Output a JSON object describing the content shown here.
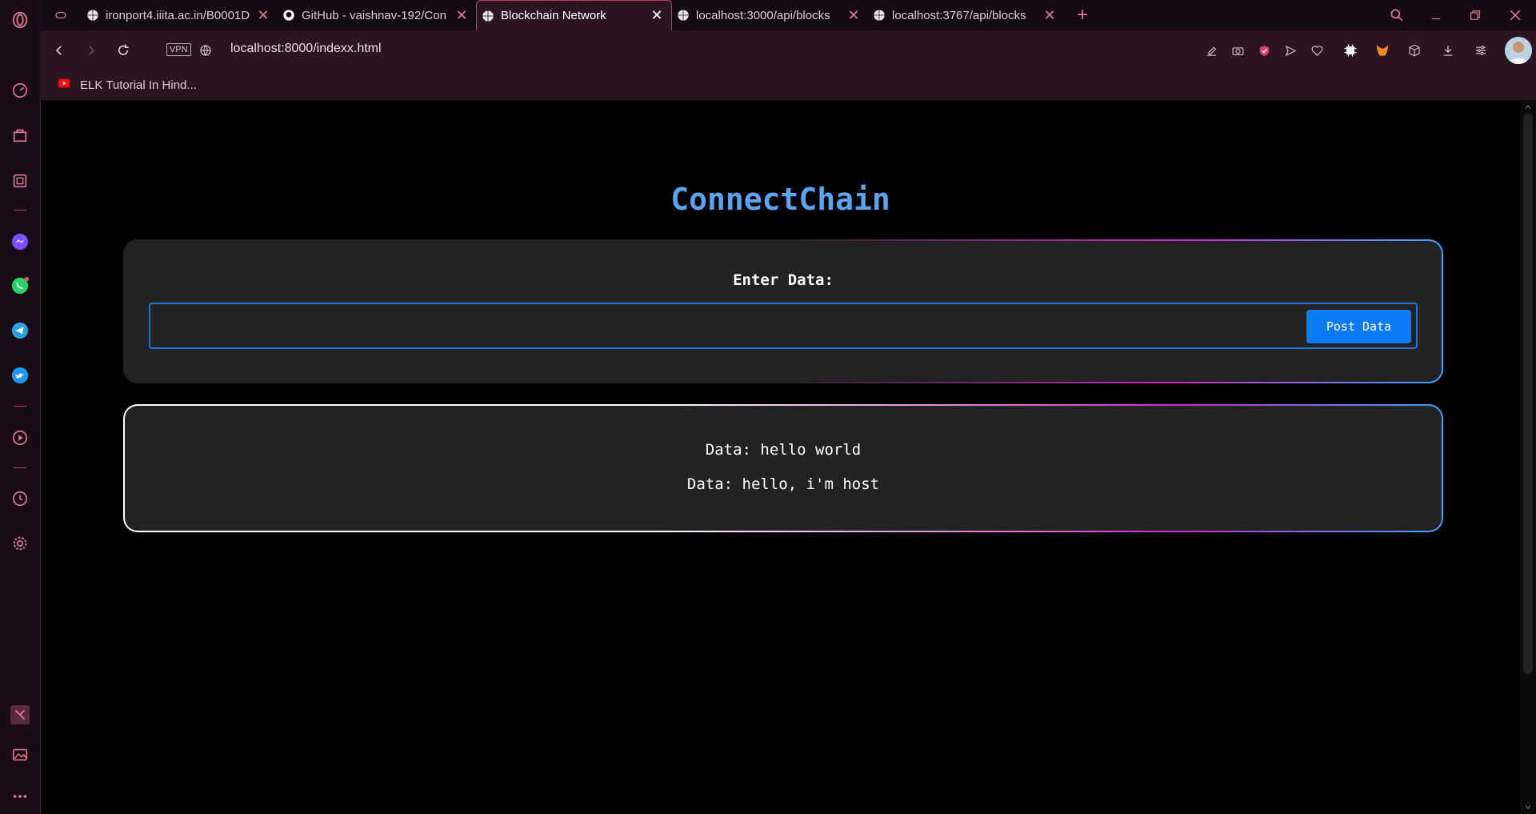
{
  "browser": {
    "tabs": [
      {
        "title": "ironport4.iiita.ac.in/B0001D",
        "active": false
      },
      {
        "title": "GitHub - vaishnav-192/Con",
        "active": false
      },
      {
        "title": "Blockchain Network",
        "active": true
      },
      {
        "title": "localhost:3000/api/blocks",
        "active": false
      },
      {
        "title": "localhost:3767/api/blocks",
        "active": false
      }
    ],
    "vpn_label": "VPN",
    "url": "localhost:8000/indexx.html",
    "bookmarks": [
      {
        "label": "ELK Tutorial In Hind..."
      }
    ],
    "accent_color": "#e07a94"
  },
  "page": {
    "title": "ConnectChain",
    "form": {
      "label": "Enter Data:",
      "input_value": "",
      "button_label": "Post Data"
    },
    "entries": [
      {
        "text": "Data: hello world"
      },
      {
        "text": "Data: hello, i'm host"
      }
    ],
    "title_color": "#5aa4f0",
    "button_color": "#0a7af5"
  }
}
